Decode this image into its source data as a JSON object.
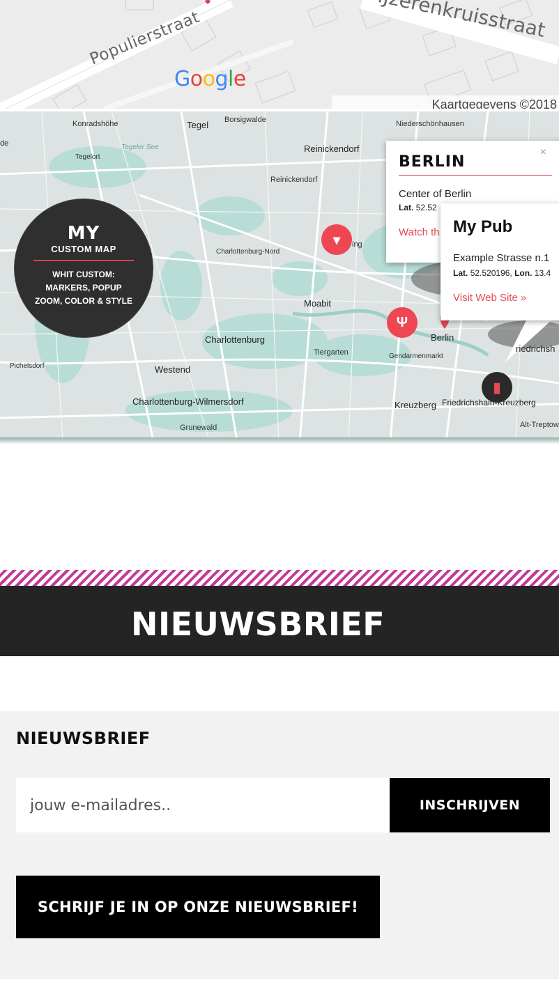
{
  "top_map": {
    "street_a": "Populierstraat",
    "street_b": "IJzerenkruisstraat",
    "logo": "Google",
    "attribution": "Kaartgegevens ©2018 Google"
  },
  "demo_map": {
    "places": {
      "konradshohe": "Konradshöhe",
      "tegel": "Tegel",
      "borsigwalde": "Borsigwalde",
      "niederschoenhausen": "Niederschönhausen",
      "tegeler_see": "Tegeler See",
      "tegelort": "Tegelort",
      "reinickendorf_1": "Reinickendorf",
      "reinickendorf_2": "Reinickendorf",
      "charlottenburg_nord": "Charlottenburg-Nord",
      "moabit": "Moabit",
      "charlottenburg": "Charlottenburg",
      "tiergarten": "Tiergarten",
      "westend": "Westend",
      "pichelsdorf": "Pichelsdorf",
      "charlottenburg_wilmersdorf": "Charlottenburg-Wilmersdorf",
      "grunewald": "Grunewald",
      "berlin": "Berlin",
      "gendarmenmarkt": "Gendarmenmarkt",
      "kreuzberg": "Kreuzberg",
      "friedrichshain_kreuzberg": "Friedrichshain-Kreuzberg",
      "alt_treptow": "Alt-Treptow",
      "friedrichsh": "riedrichsh",
      "de": "de",
      "ing": "ing"
    },
    "badge": {
      "line1": "MY",
      "line2": "CUSTOM MAP",
      "line3": "WHIT CUSTOM: MARKERS, POPUP ZOOM, COLOR & STYLE"
    },
    "popup_berlin": {
      "title": "BERLIN",
      "subtitle": "Center of Berlin",
      "lat_label": "Lat.",
      "lat_value": "52.52",
      "link": "Watch th",
      "close": "×"
    },
    "popup_pub": {
      "title": "My Pub",
      "address": "Example Strasse n.1",
      "lat_label": "Lat.",
      "lat_value": "52.520196,",
      "lon_label": "Lon.",
      "lon_value": "13.4",
      "link": "Visit Web Site »"
    }
  },
  "banner": {
    "title": "NIEUWSBRIEF"
  },
  "newsletter": {
    "heading": "NIEUWSBRIEF",
    "email_placeholder": "jouw e-mailadres..",
    "subscribe_label": "INSCHRIJVEN",
    "cta_label": "SCHRIJF JE IN OP ONZE NIEUWSBRIEF!"
  },
  "colors": {
    "accent_red": "#e34a55",
    "stripe_magenta": "#c23a97",
    "banner_bg": "#242424"
  }
}
